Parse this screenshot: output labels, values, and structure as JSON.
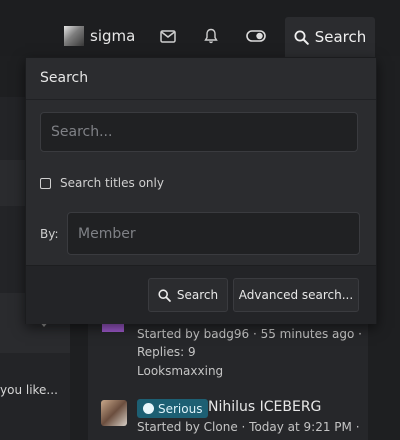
{
  "nav": {
    "username": "sigma",
    "icons": [
      "envelope-icon",
      "bell-icon",
      "toggle-icon"
    ],
    "search_label": "Search"
  },
  "background": {
    "liked_snippet": "you like...",
    "thread1": {
      "started_by": "Started by badg96 · 55 minutes ago ·",
      "replies": "Replies: 9",
      "forum": "Looksmaxxing"
    },
    "thread2": {
      "badge": "Serious",
      "title": "Nihilus ICEBERG",
      "started_by": "Started by Clone · Today at 9:21 PM ·"
    }
  },
  "search_panel": {
    "title": "Search",
    "query_placeholder": "Search...",
    "titles_only_label": "Search titles only",
    "titles_only_checked": false,
    "by_label": "By:",
    "member_placeholder": "Member",
    "search_button": "Search",
    "advanced_button": "Advanced search..."
  },
  "colors": {
    "accent_badge": "#1d5f73",
    "panel_bg": "#2b2c2f",
    "page_bg": "#1e1f21"
  }
}
